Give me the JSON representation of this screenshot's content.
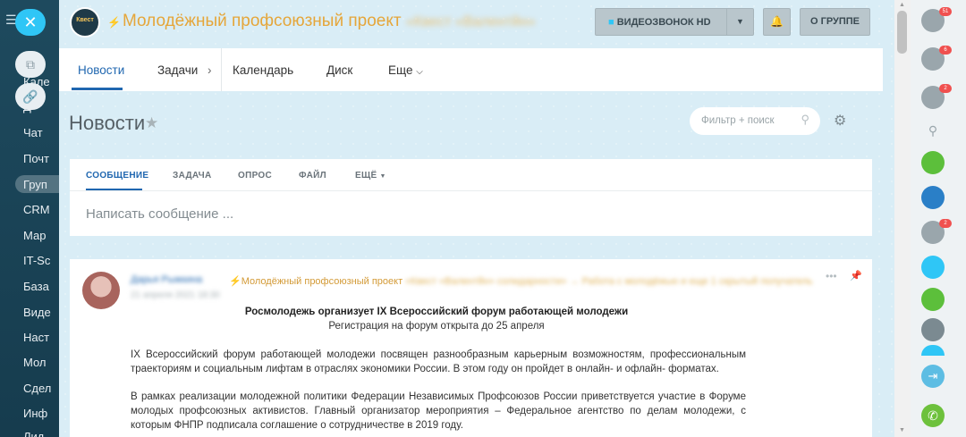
{
  "sidebar": {
    "items": [
      "Кале",
      "Д",
      "Чат",
      "Почт",
      "Груп",
      "CRM",
      "Мар",
      "IT-Sc",
      "База",
      "Виде",
      "Наст",
      "Мол",
      "Сдел",
      "Инф",
      "Лид"
    ]
  },
  "header": {
    "avatar_text": "Квест",
    "group_title": "Молодёжный профсоюзный проект",
    "group_title_blurred": "«Квест «Валентйн»",
    "video_button": "ВИДЕОЗВОНОК HD",
    "group_button": "О ГРУППЕ"
  },
  "tabs": [
    "Новости",
    "Задачи",
    "Календарь",
    "Диск",
    "Еще"
  ],
  "page": {
    "title": "Новости",
    "filter_placeholder": "Фильтр + поиск"
  },
  "composer": {
    "tabs": [
      "СООБЩЕНИЕ",
      "ЗАДАЧА",
      "ОПРОС",
      "ФАЙЛ",
      "ЕЩЁ"
    ],
    "placeholder": "Написать сообщение ..."
  },
  "post": {
    "author": "Дарья Рыжкина",
    "group": "Молодёжный профсоюзный проект",
    "group_tail_blurred": "«Квест «Валентйн» солидарности» → Работа с молодёжью и еще 1 скрытый получатель",
    "date": "21 апреля 2021 18:30",
    "heading": "Росмолодежь организует IX Всероссийский форум работающей молодежи",
    "subheading": "Регистрация на форум открыта до 25 апреля",
    "paragraphs": [
      "IX Всероссийский форум работающей молодежи посвящен разнообразным карьерным возможностям, профессиональным траекториям и социальным лифтам в отраслях экономики России. В этом году он пройдет в онлайн- и офлайн- форматах.",
      "В рамках реализации молодежной политики Федерации Независимых Профсоюзов России приветствуется участие в Форуме молодых профсоюзных активистов. Главный организатор мероприятия – Федеральное агентство по делам молодежи, с которым ФНПР подписала соглашение о сотрудничестве в 2019 году."
    ]
  },
  "right_sidebar": {
    "badges": [
      "51",
      "6",
      "2",
      "2"
    ]
  },
  "colors": {
    "accent": "#2067b0",
    "group_title": "#e5a63a",
    "sidebar": "#1e4a5e",
    "close_button": "#2fc6f6"
  }
}
